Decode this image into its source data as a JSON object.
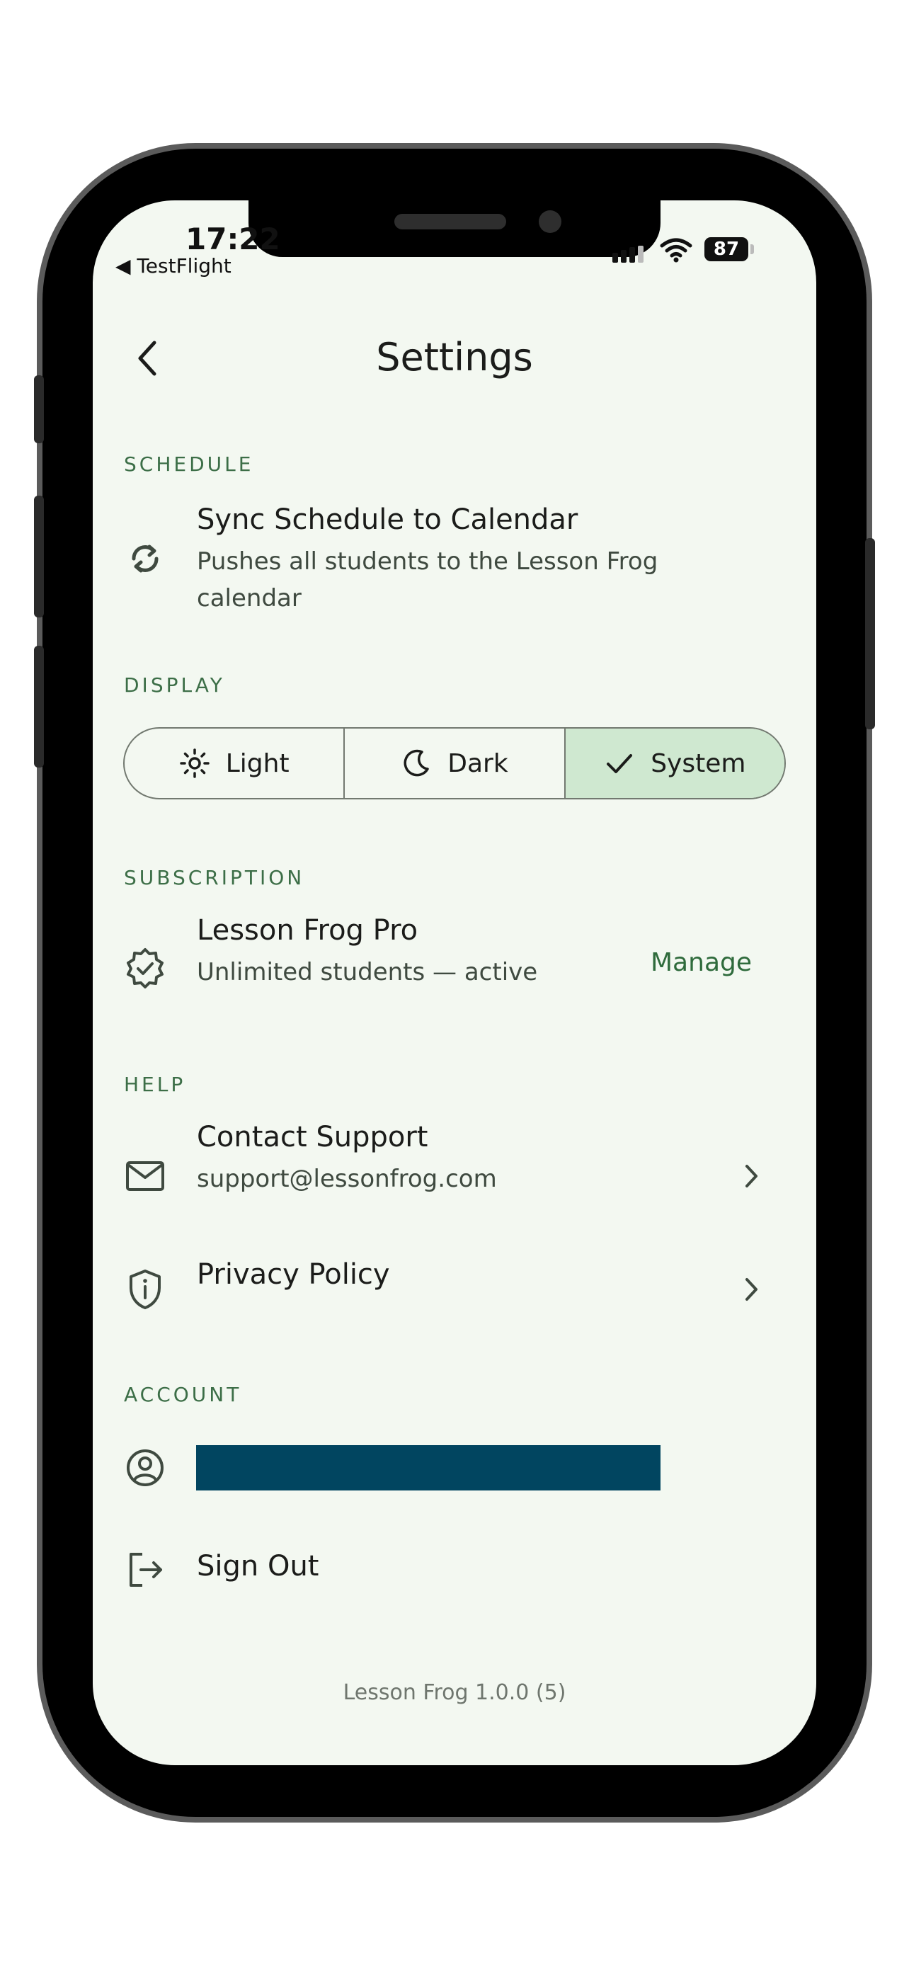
{
  "status_bar": {
    "time": "17:22",
    "back_app": "◀ TestFlight",
    "battery": "87"
  },
  "header": {
    "title": "Settings"
  },
  "sections": {
    "schedule": {
      "header": "SCHEDULE",
      "sync": {
        "title": "Sync Schedule to Calendar",
        "subtitle": "Pushes all students to the Lesson Frog calendar"
      }
    },
    "display": {
      "header": "DISPLAY",
      "options": [
        {
          "label": "Light",
          "icon": "sun-icon",
          "selected": false
        },
        {
          "label": "Dark",
          "icon": "moon-icon",
          "selected": false
        },
        {
          "label": "System",
          "icon": "check-icon",
          "selected": true
        }
      ]
    },
    "subscription": {
      "header": "SUBSCRIPTION",
      "title": "Lesson Frog Pro",
      "subtitle": "Unlimited students — active",
      "action": "Manage"
    },
    "help": {
      "header": "HELP",
      "contact": {
        "title": "Contact Support",
        "subtitle": "support@lessonfrog.com"
      },
      "privacy": {
        "title": "Privacy Policy"
      }
    },
    "account": {
      "header": "ACCOUNT",
      "sign_out": "Sign Out"
    }
  },
  "footer": {
    "version": "Lesson Frog 1.0.0 (5)"
  },
  "colors": {
    "background": "#f3f8f1",
    "accent": "#3c6e47",
    "selected": "#cfe8d0",
    "redaction": "#014560"
  }
}
